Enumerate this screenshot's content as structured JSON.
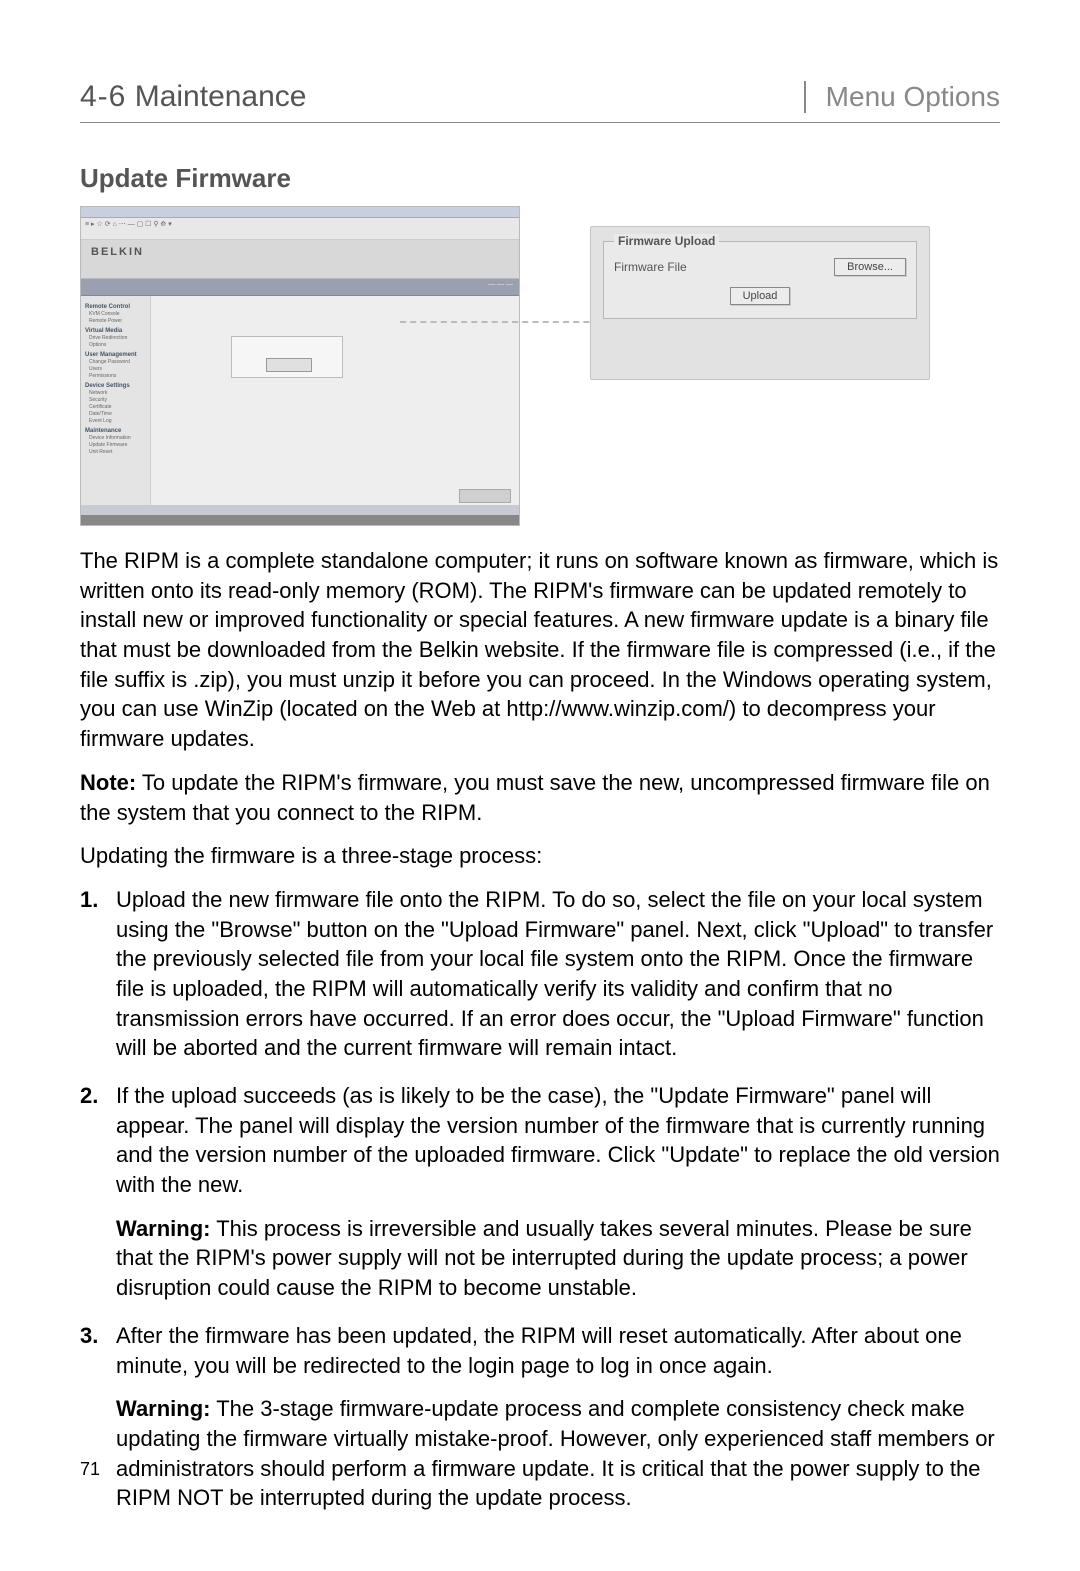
{
  "header": {
    "section_number": "4-6",
    "section_title": "Maintenance",
    "right_label": "Menu Options"
  },
  "section_heading": "Update Firmware",
  "screenshot": {
    "brand": "BELKIN",
    "toolbar_hint": "≡ ▸  ☆ ⟳ ⌂ ⋯ — ▢ ☐ ⚲  ⟰ ▾",
    "subbar_right": "—  —  —",
    "sidebar": {
      "groups": [
        {
          "head": "Remote Control",
          "items": [
            "KVM Console",
            "Remote Power"
          ]
        },
        {
          "head": "Virtual Media",
          "items": [
            "Drive Redirection",
            "Options"
          ]
        },
        {
          "head": "User Management",
          "items": [
            "Change Password",
            "Users",
            "Permissions"
          ]
        },
        {
          "head": "Device Settings",
          "items": [
            "Network",
            "Security",
            "Certificate",
            "Date/Time",
            "Event Log"
          ]
        },
        {
          "head": "Maintenance",
          "items": [
            "Device Information",
            "Update Firmware",
            "Unit Reset"
          ]
        }
      ]
    }
  },
  "callout": {
    "legend": "Firmware Upload",
    "file_label": "Firmware File",
    "browse_label": "Browse...",
    "upload_label": "Upload"
  },
  "paragraphs": {
    "p1": "The RIPM is a complete standalone computer; it runs on software known as firmware, which is written onto its read-only memory (ROM). The RIPM's firmware can be updated remotely to install new or improved functionality or special features. A new firmware update is a binary file that must be downloaded from the Belkin website. If the firmware file is compressed (i.e., if the file suffix is .zip), you must unzip it before you can proceed. In the Windows operating system, you can use WinZip (located on the Web at http://www.winzip.com/) to decompress your firmware updates.",
    "note_label": "Note:",
    "note_text": " To update the RIPM's firmware, you must save the new, uncompressed firmware file on the system that you connect to the RIPM.",
    "p2": "Updating the firmware is a three-stage process:"
  },
  "steps": {
    "s1": "Upload the new firmware file onto the RIPM. To do so, select the file on your local system using the \"Browse\" button on the \"Upload Firmware\" panel. Next, click \"Upload\" to transfer the previously selected file from your local file system onto the RIPM. Once the firmware file is uploaded, the RIPM will automatically verify its validity and confirm that no transmission errors have occurred. If an error does occur, the \"Upload Firmware\" function will be aborted and the current firmware will remain intact.",
    "s2": "If the upload succeeds (as is likely to be the case), the \"Update Firmware\" panel will appear. The panel will display the version number of the firmware that is currently running and the version number of the uploaded firmware. Click \"Update\" to replace the old version with the new.",
    "s2_warn_label": "Warning:",
    "s2_warn": " This process is irreversible and usually takes several minutes. Please be sure that the RIPM's power supply will not be interrupted during the update process; a power disruption could cause the RIPM to become unstable.",
    "s3": "After the firmware has been updated, the RIPM will reset automatically. After about one minute, you will be redirected to the login page to log in once again.",
    "s3_warn_label": "Warning:",
    "s3_warn": " The 3-stage firmware-update process and complete consistency check make updating the firmware virtually mistake-proof. However, only experienced staff members or administrators should perform a firmware update. It is critical that the power supply to the RIPM NOT be interrupted during the update process."
  },
  "page_number": "71"
}
